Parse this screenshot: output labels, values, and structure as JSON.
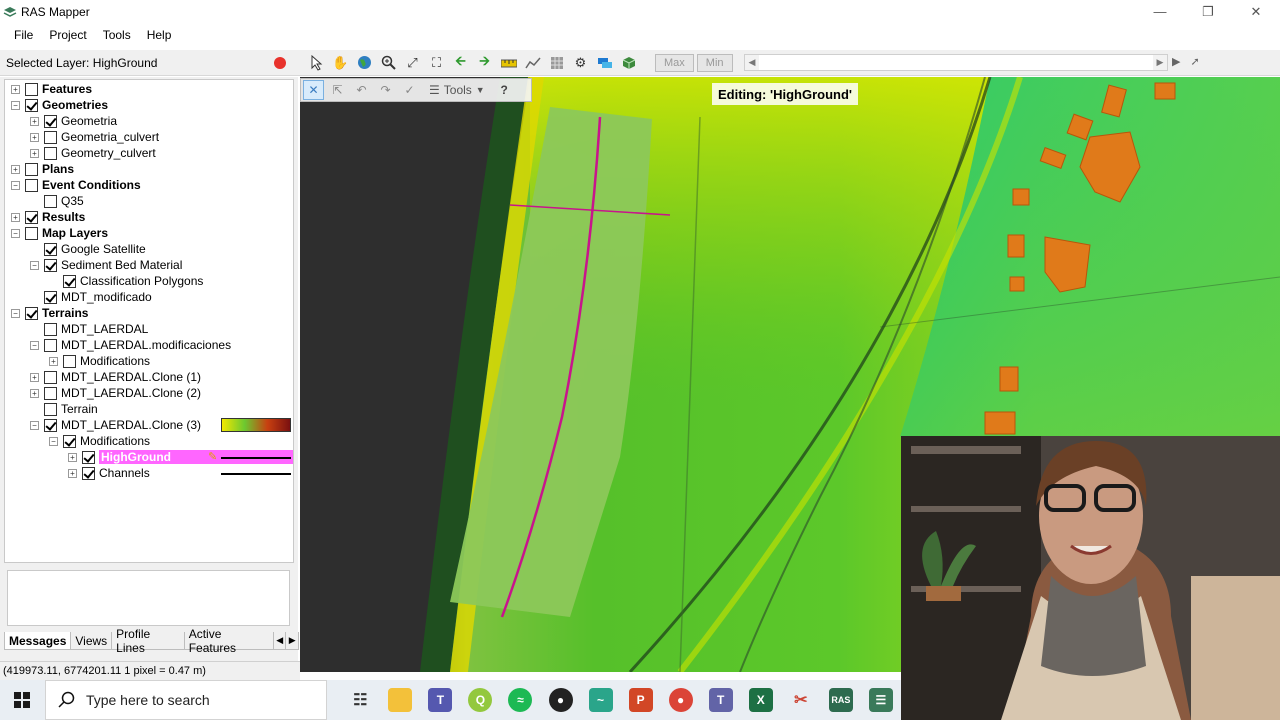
{
  "window": {
    "title": "RAS Mapper",
    "controls": [
      "minimize",
      "restore",
      "close"
    ]
  },
  "menu": [
    "File",
    "Project",
    "Tools",
    "Help"
  ],
  "toolbar": {
    "selected_layer": "Selected Layer: HighGround",
    "max_label": "Max",
    "min_label": "Min"
  },
  "tree": [
    {
      "label": "Features",
      "bold": true,
      "checked": false,
      "expander": "+",
      "indent": 0
    },
    {
      "label": "Geometries",
      "bold": true,
      "checked": true,
      "expander": "-",
      "indent": 0
    },
    {
      "label": "Geometria",
      "bold": false,
      "checked": true,
      "expander": "+",
      "indent": 1
    },
    {
      "label": "Geometria_culvert",
      "bold": false,
      "checked": false,
      "expander": "+",
      "indent": 1
    },
    {
      "label": "Geometry_culvert",
      "bold": false,
      "checked": false,
      "expander": "+",
      "indent": 1
    },
    {
      "label": "Plans",
      "bold": true,
      "checked": false,
      "expander": "+",
      "indent": 0
    },
    {
      "label": "Event Conditions",
      "bold": true,
      "checked": false,
      "expander": "-",
      "indent": 0
    },
    {
      "label": "Q35",
      "bold": false,
      "checked": false,
      "expander": "",
      "indent": 1
    },
    {
      "label": "Results",
      "bold": true,
      "checked": true,
      "expander": "+",
      "indent": 0
    },
    {
      "label": "Map Layers",
      "bold": true,
      "checked": false,
      "expander": "-",
      "indent": 0
    },
    {
      "label": "Google Satellite",
      "bold": false,
      "checked": true,
      "expander": "",
      "indent": 1
    },
    {
      "label": "Sediment Bed Material",
      "bold": false,
      "checked": true,
      "expander": "-",
      "indent": 1
    },
    {
      "label": "Classification Polygons",
      "bold": false,
      "checked": true,
      "expander": "",
      "indent": 2
    },
    {
      "label": "MDT_modificado",
      "bold": false,
      "checked": true,
      "expander": "",
      "indent": 1
    },
    {
      "label": "Terrains",
      "bold": true,
      "checked": true,
      "expander": "-",
      "indent": 0
    },
    {
      "label": "MDT_LAERDAL",
      "bold": false,
      "checked": false,
      "expander": "",
      "indent": 1
    },
    {
      "label": "MDT_LAERDAL.modificaciones",
      "bold": false,
      "checked": false,
      "expander": "-",
      "indent": 1
    },
    {
      "label": "Modifications",
      "bold": false,
      "checked": false,
      "expander": "+",
      "indent": 2
    },
    {
      "label": "MDT_LAERDAL.Clone (1)",
      "bold": false,
      "checked": false,
      "expander": "+",
      "indent": 1
    },
    {
      "label": "MDT_LAERDAL.Clone (2)",
      "bold": false,
      "checked": false,
      "expander": "+",
      "indent": 1
    },
    {
      "label": "Terrain",
      "bold": false,
      "checked": false,
      "expander": "",
      "indent": 1
    },
    {
      "label": "MDT_LAERDAL.Clone (3)",
      "bold": false,
      "checked": true,
      "expander": "-",
      "indent": 1,
      "legend": "ramp"
    },
    {
      "label": "Modifications",
      "bold": false,
      "checked": true,
      "expander": "-",
      "indent": 2
    },
    {
      "label": "HighGround",
      "bold": true,
      "checked": true,
      "expander": "+",
      "indent": 3,
      "highlight": true,
      "legend": "line"
    },
    {
      "label": "Channels",
      "bold": false,
      "checked": true,
      "expander": "+",
      "indent": 3,
      "legend": "line"
    }
  ],
  "bottom_tabs": [
    "Messages",
    "Views",
    "Profile Lines",
    "Active Features"
  ],
  "status": "(419973.11, 6774201.11  1 pixel = 0.47 m)",
  "map": {
    "tools_label": "Tools",
    "help_label": "?",
    "editing_label": "Editing: 'HighGround'"
  },
  "taskbar": {
    "search_placeholder": "Type here to search",
    "apps": [
      "task-view",
      "file-explorer",
      "teams",
      "qgis",
      "spotify",
      "obs",
      "maps",
      "powerpoint",
      "chrome",
      "teams-work",
      "excel",
      "snipping-tool",
      "hec-ras",
      "ras-mapper"
    ]
  },
  "colors": {
    "highlight": "#ff66ff",
    "record": "#e8322c",
    "breakline": "#c8148c"
  }
}
